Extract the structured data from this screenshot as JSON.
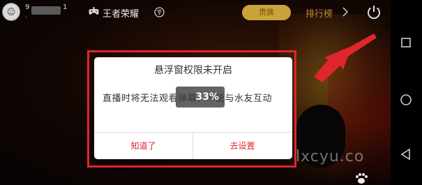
{
  "top_bar": {
    "user_num_start": "9",
    "user_num_end": "1",
    "user_sub": "·",
    "game_name": "王者荣耀",
    "ranking_pill": "贵族",
    "leaderboard": "排行榜"
  },
  "dialog": {
    "title": "悬浮窗权限未开启",
    "message": "直播时将无法观看弹幕，不能与水友互动",
    "progress_text": "33%",
    "progress_value": 0.33,
    "dismiss_label": "知道了",
    "settings_label": "去设置"
  },
  "watermark": "lxcyu.co",
  "colors": {
    "accent_red": "#e0252c",
    "gold": "#c9a33a",
    "leaderboard": "#c98a3a"
  },
  "icons": {
    "avatar": "avatar-icon",
    "game": "gamepad-icon",
    "switch": "switch-icon",
    "chevron": "chevron-right-icon",
    "power": "power-icon",
    "nav_recent": "square-icon",
    "nav_home": "circle-icon",
    "nav_back": "triangle-back-icon"
  }
}
